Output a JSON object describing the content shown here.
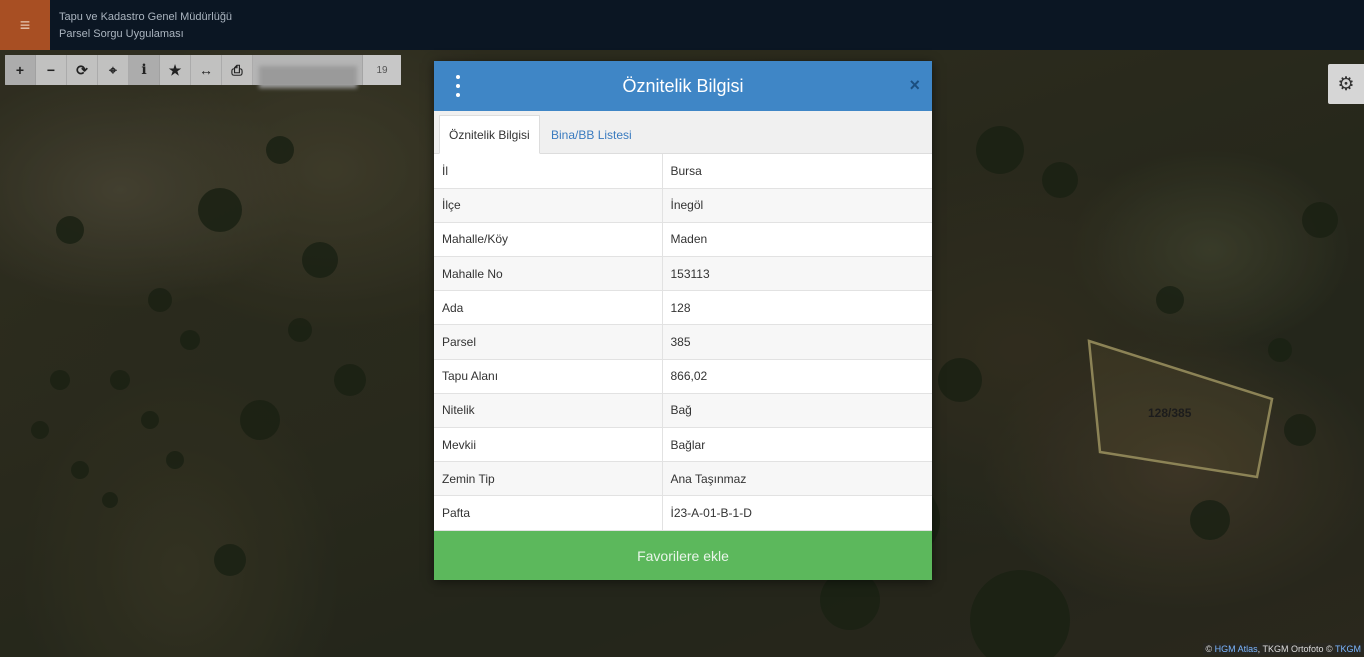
{
  "header": {
    "menu_icon": "hamburger-icon",
    "title_line1": "Tapu ve Kadastro Genel Müdürlüğü",
    "title_line2": "Parsel Sorgu Uygulaması"
  },
  "toolbar": {
    "tools": [
      {
        "name": "zoom-in-icon",
        "glyph": "+"
      },
      {
        "name": "zoom-out-icon",
        "glyph": "−"
      },
      {
        "name": "refresh-icon",
        "glyph": "⟳"
      },
      {
        "name": "locate-icon",
        "glyph": "⌖"
      },
      {
        "name": "info-icon",
        "glyph": "i"
      },
      {
        "name": "star-icon",
        "glyph": "★"
      },
      {
        "name": "measure-icon",
        "glyph": "↔"
      },
      {
        "name": "print-icon",
        "glyph": "⎙"
      }
    ],
    "zoom_level": "19"
  },
  "settings": {
    "icon": "gear-icon",
    "glyph": "⚙"
  },
  "map": {
    "parcel_label": "128/385",
    "parcel_outline_color": "#8c8356",
    "attribution_prefix": "©",
    "attribution_link1": "HGM Atlas",
    "attribution_middle": ", TKGM Ortofoto ©",
    "attribution_link2": "TKGM"
  },
  "dialog": {
    "title": "Öznitelik Bilgisi",
    "close_glyph": "×",
    "tabs": [
      {
        "label": "Öznitelik Bilgisi",
        "active": true
      },
      {
        "label": "Bina/BB Listesi",
        "active": false
      }
    ],
    "rows": [
      {
        "key": "İl",
        "value": "Bursa"
      },
      {
        "key": "İlçe",
        "value": "İnegöl"
      },
      {
        "key": "Mahalle/Köy",
        "value": "Maden"
      },
      {
        "key": "Mahalle No",
        "value": "153113"
      },
      {
        "key": "Ada",
        "value": "128"
      },
      {
        "key": "Parsel",
        "value": "385"
      },
      {
        "key": "Tapu Alanı",
        "value": "866,02"
      },
      {
        "key": "Nitelik",
        "value": "Bağ"
      },
      {
        "key": "Mevkii",
        "value": "Bağlar"
      },
      {
        "key": "Zemin Tip",
        "value": "Ana Taşınmaz"
      },
      {
        "key": "Pafta",
        "value": "İ23-A-01-B-1-D"
      }
    ],
    "favorite_label": "Favorilere ekle",
    "header_color": "#3f86c6",
    "button_color": "#5cb85c"
  }
}
